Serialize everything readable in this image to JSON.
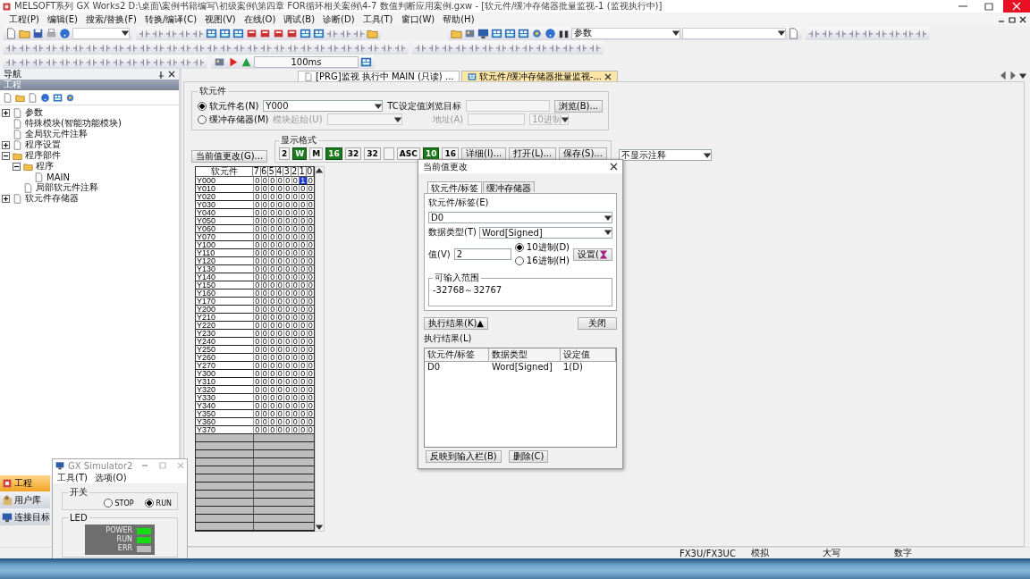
{
  "window": {
    "title": "MELSOFT系列 GX Works2 D:\\桌面\\案例书籍编写\\初级案例\\第四章 FOR循环相关案例\\4-7 数值判断应用案例.gxw - [软元件/缓冲存储器批量监视-1 (监视执行中)]"
  },
  "menu": [
    "工程(P)",
    "编辑(E)",
    "搜索/替换(F)",
    "转换/编译(C)",
    "视图(V)",
    "在线(O)",
    "调试(B)",
    "诊断(D)",
    "工具(T)",
    "窗口(W)",
    "帮助(H)"
  ],
  "toolbar": {
    "search_value": "参数",
    "interval": "100ms"
  },
  "navigation": {
    "title": "导航",
    "section": "工程",
    "tree": [
      {
        "label": "参数",
        "expanded": false
      },
      {
        "label": "特殊模块(智能功能模块)"
      },
      {
        "label": "全局软元件注释"
      },
      {
        "label": "程序设置",
        "expanded": false
      },
      {
        "label": "程序部件",
        "expanded": true,
        "children": [
          {
            "label": "程序",
            "expanded": true,
            "children": [
              {
                "label": "MAIN"
              }
            ]
          },
          {
            "label": "局部软元件注释"
          }
        ]
      },
      {
        "label": "软元件存储器",
        "expanded": false
      }
    ],
    "buttons": [
      {
        "label": "工程",
        "selected": true
      },
      {
        "label": "用户库",
        "selected": false
      },
      {
        "label": "连接目标",
        "selected": false
      }
    ]
  },
  "tabs": [
    {
      "label": "[PRG]监视 执行中 MAIN (只读) ...",
      "selected": false
    },
    {
      "label": "软元件/缓冲存储器批量监视-...",
      "selected": true
    }
  ],
  "monitor": {
    "group": "软元件",
    "device_radio": {
      "label": "软元件名(N)",
      "selected": true
    },
    "device_value": "Y000",
    "tc_label": "TC设定值浏览目标",
    "browse_button": "浏览(B)...",
    "buffer_radio": {
      "label": "缓冲存储器(M)",
      "selected": false
    },
    "module_label": "模块起始(U)",
    "address_label": "地址(A)",
    "radix_value": "10进制",
    "change_button": "当前值更改(G)...",
    "format_group": "显示格式",
    "formats": [
      {
        "text": "2",
        "selected": false
      },
      {
        "text": "W",
        "selected": true
      },
      {
        "text": "M",
        "selected": false
      },
      {
        "text": "16",
        "selected": true
      },
      {
        "text": "32",
        "selected": false
      },
      {
        "text": "32",
        "selected": false
      },
      {
        "selected": false
      },
      {
        "text": "ASC",
        "selected": false
      },
      {
        "text": "10",
        "selected": true
      },
      {
        "text": "16",
        "selected": false
      }
    ],
    "buttons": [
      "详细(I)...",
      "打开(L)...",
      "保存(S)..."
    ],
    "comment_select": "不显示注释",
    "columns": [
      "软元件",
      "7",
      "6",
      "5",
      "4",
      "3",
      "2",
      "1",
      "0"
    ],
    "rows": [
      {
        "device": "Y000",
        "bits": [
          "0",
          "0",
          "0",
          "0",
          "0",
          "0",
          "1",
          "0"
        ]
      },
      {
        "device": "Y010",
        "bits": [
          "0",
          "0",
          "0",
          "0",
          "0",
          "0",
          "0",
          "0"
        ]
      },
      {
        "device": "Y020",
        "bits": [
          "0",
          "0",
          "0",
          "0",
          "0",
          "0",
          "0",
          "0"
        ]
      },
      {
        "device": "Y030",
        "bits": [
          "0",
          "0",
          "0",
          "0",
          "0",
          "0",
          "0",
          "0"
        ]
      },
      {
        "device": "Y040",
        "bits": [
          "0",
          "0",
          "0",
          "0",
          "0",
          "0",
          "0",
          "0"
        ]
      },
      {
        "device": "Y050",
        "bits": [
          "0",
          "0",
          "0",
          "0",
          "0",
          "0",
          "0",
          "0"
        ]
      },
      {
        "device": "Y060",
        "bits": [
          "0",
          "0",
          "0",
          "0",
          "0",
          "0",
          "0",
          "0"
        ]
      },
      {
        "device": "Y070",
        "bits": [
          "0",
          "0",
          "0",
          "0",
          "0",
          "0",
          "0",
          "0"
        ]
      },
      {
        "device": "Y100",
        "bits": [
          "0",
          "0",
          "0",
          "0",
          "0",
          "0",
          "0",
          "0"
        ]
      },
      {
        "device": "Y110",
        "bits": [
          "0",
          "0",
          "0",
          "0",
          "0",
          "0",
          "0",
          "0"
        ]
      },
      {
        "device": "Y120",
        "bits": [
          "0",
          "0",
          "0",
          "0",
          "0",
          "0",
          "0",
          "0"
        ]
      },
      {
        "device": "Y130",
        "bits": [
          "0",
          "0",
          "0",
          "0",
          "0",
          "0",
          "0",
          "0"
        ]
      },
      {
        "device": "Y140",
        "bits": [
          "0",
          "0",
          "0",
          "0",
          "0",
          "0",
          "0",
          "0"
        ]
      },
      {
        "device": "Y150",
        "bits": [
          "0",
          "0",
          "0",
          "0",
          "0",
          "0",
          "0",
          "0"
        ]
      },
      {
        "device": "Y160",
        "bits": [
          "0",
          "0",
          "0",
          "0",
          "0",
          "0",
          "0",
          "0"
        ]
      },
      {
        "device": "Y170",
        "bits": [
          "0",
          "0",
          "0",
          "0",
          "0",
          "0",
          "0",
          "0"
        ]
      },
      {
        "device": "Y200",
        "bits": [
          "0",
          "0",
          "0",
          "0",
          "0",
          "0",
          "0",
          "0"
        ]
      },
      {
        "device": "Y210",
        "bits": [
          "0",
          "0",
          "0",
          "0",
          "0",
          "0",
          "0",
          "0"
        ]
      },
      {
        "device": "Y220",
        "bits": [
          "0",
          "0",
          "0",
          "0",
          "0",
          "0",
          "0",
          "0"
        ]
      },
      {
        "device": "Y230",
        "bits": [
          "0",
          "0",
          "0",
          "0",
          "0",
          "0",
          "0",
          "0"
        ]
      },
      {
        "device": "Y240",
        "bits": [
          "0",
          "0",
          "0",
          "0",
          "0",
          "0",
          "0",
          "0"
        ]
      },
      {
        "device": "Y250",
        "bits": [
          "0",
          "0",
          "0",
          "0",
          "0",
          "0",
          "0",
          "0"
        ]
      },
      {
        "device": "Y260",
        "bits": [
          "0",
          "0",
          "0",
          "0",
          "0",
          "0",
          "0",
          "0"
        ]
      },
      {
        "device": "Y270",
        "bits": [
          "0",
          "0",
          "0",
          "0",
          "0",
          "0",
          "0",
          "0"
        ]
      },
      {
        "device": "Y300",
        "bits": [
          "0",
          "0",
          "0",
          "0",
          "0",
          "0",
          "0",
          "0"
        ]
      },
      {
        "device": "Y310",
        "bits": [
          "0",
          "0",
          "0",
          "0",
          "0",
          "0",
          "0",
          "0"
        ]
      },
      {
        "device": "Y320",
        "bits": [
          "0",
          "0",
          "0",
          "0",
          "0",
          "0",
          "0",
          "0"
        ]
      },
      {
        "device": "Y330",
        "bits": [
          "0",
          "0",
          "0",
          "0",
          "0",
          "0",
          "0",
          "0"
        ]
      },
      {
        "device": "Y340",
        "bits": [
          "0",
          "0",
          "0",
          "0",
          "0",
          "0",
          "0",
          "0"
        ]
      },
      {
        "device": "Y350",
        "bits": [
          "0",
          "0",
          "0",
          "0",
          "0",
          "0",
          "0",
          "0"
        ]
      },
      {
        "device": "Y360",
        "bits": [
          "0",
          "0",
          "0",
          "0",
          "0",
          "0",
          "0",
          "0"
        ]
      },
      {
        "device": "Y370",
        "bits": [
          "0",
          "0",
          "0",
          "0",
          "0",
          "0",
          "0",
          "0"
        ]
      }
    ]
  },
  "dialog": {
    "title": "当前值更改",
    "tabs": [
      {
        "label": "软元件/标签",
        "selected": true
      },
      {
        "label": "缓冲存储器",
        "selected": false
      }
    ],
    "device_label": "软元件/标签(E)",
    "device_value": "D0",
    "type_label": "数据类型(T)",
    "type_value": "Word[Signed]",
    "value_label": "值(V)",
    "value": "2",
    "radix": [
      {
        "label": "10进制(D)",
        "selected": true
      },
      {
        "label": "16进制(H)",
        "selected": false
      }
    ],
    "set_button": "设置(",
    "range_label": "可输入范围",
    "range": "-32768～32767",
    "result_toggle": "执行结果(K)▲",
    "close_button": "关闭",
    "result_label": "执行结果(L)",
    "result_columns": [
      "软元件/标签",
      "数据类型",
      "设定值"
    ],
    "result_rows": [
      [
        "D0",
        "Word[Signed]",
        "1(D)"
      ]
    ],
    "bottom_buttons": [
      "反映到输入栏(B)",
      "删除(C)"
    ]
  },
  "simulator": {
    "title": "GX Simulator2",
    "menu": [
      "工具(T)",
      "选项(O)"
    ],
    "switch_label": "开关",
    "switch": [
      {
        "label": "STOP",
        "selected": false
      },
      {
        "label": "RUN",
        "selected": true
      }
    ],
    "led_label": "LED",
    "leds": [
      {
        "label": "POWER",
        "on": true
      },
      {
        "label": "RUN",
        "on": true
      },
      {
        "label": "ERR",
        "on": false
      }
    ]
  },
  "status_bar": [
    "FX3U/FX3UC",
    "模拟",
    "大写",
    "数字"
  ]
}
